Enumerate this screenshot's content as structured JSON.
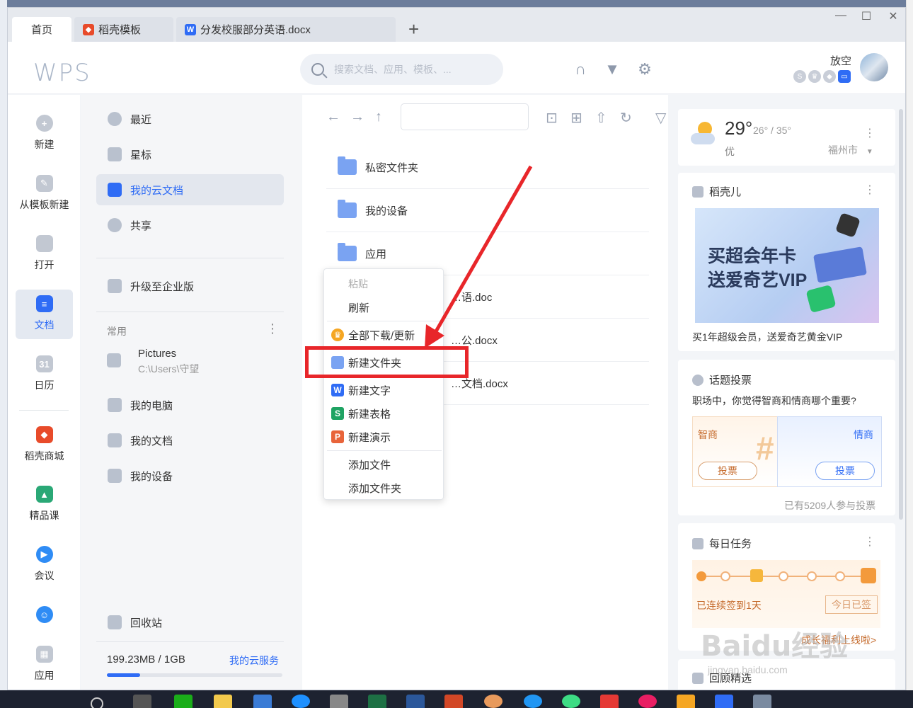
{
  "tabs": [
    {
      "label": "首页"
    },
    {
      "label": "稻壳模板"
    },
    {
      "label": "分发校服部分英语.docx"
    }
  ],
  "header": {
    "logo": "WPS",
    "search_placeholder": "搜索文档、应用、模板、...",
    "username": "放空"
  },
  "leftnav": [
    {
      "label": "新建"
    },
    {
      "label": "从模板新建"
    },
    {
      "label": "打开"
    },
    {
      "label": "文档"
    },
    {
      "label": "日历"
    },
    {
      "label": "稻壳商城"
    },
    {
      "label": "精品课"
    },
    {
      "label": "会议"
    },
    {
      "label": "应用"
    }
  ],
  "sidebar": {
    "items": [
      {
        "label": "最近"
      },
      {
        "label": "星标"
      },
      {
        "label": "我的云文档"
      },
      {
        "label": "共享"
      },
      {
        "label": "升级至企业版"
      }
    ],
    "section_label": "常用",
    "pictures_name": "Pictures",
    "pictures_path": "C:\\Users\\守望",
    "common": [
      {
        "label": "我的电脑"
      },
      {
        "label": "我的文档"
      },
      {
        "label": "我的设备"
      }
    ],
    "recycle": "回收站",
    "storage": "199.23MB / 1GB",
    "cloud_service": "我的云服务",
    "storage_used_fraction": 0.19
  },
  "files": [
    {
      "name": "私密文件夹"
    },
    {
      "name": "我的设备"
    },
    {
      "name": "应用"
    },
    {
      "name": "…语.doc"
    },
    {
      "name": "…公.docx"
    },
    {
      "name": "…文档.docx"
    }
  ],
  "context_menu": {
    "paste": "粘贴",
    "refresh": "刷新",
    "download_all": "全部下载/更新",
    "new_folder": "新建文件夹",
    "new_text": "新建文字",
    "new_sheet": "新建表格",
    "new_slide": "新建演示",
    "add_file": "添加文件",
    "add_folder": "添加文件夹"
  },
  "weather": {
    "temp": "29°",
    "range": "26° / 35°",
    "quality": "优",
    "city": "福州市"
  },
  "daoke": {
    "title": "稻壳儿",
    "banner_line1": "买超会年卡",
    "banner_line2": "送爱奇艺VIP",
    "caption": "买1年超级会员，送爱奇艺黄金VIP"
  },
  "vote": {
    "title": "话题投票",
    "question": "职场中，你觉得智商和情商哪个重要?",
    "left_option": "智商",
    "right_option": "情商",
    "vote_label": "投票",
    "participants": "已有5209人参与投票"
  },
  "tasks": {
    "title": "每日任务",
    "streak": "已连续签到1天",
    "signed": "今日已签",
    "growth_link": "成长福利上线啦>"
  },
  "bottom_card": {
    "title": "回顾精选"
  },
  "watermark": {
    "brand": "Baidu经验",
    "url": "jingyan.baidu.com"
  }
}
